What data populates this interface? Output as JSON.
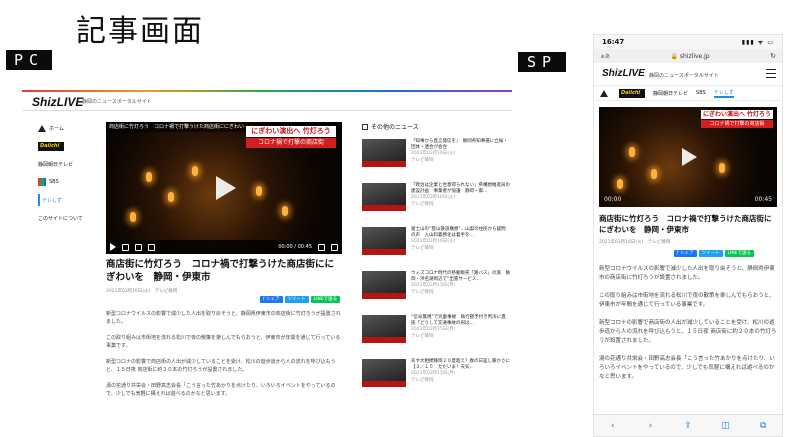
{
  "page_title": "記事画面",
  "labels": {
    "pc": "PC",
    "sp": "SP"
  },
  "site": {
    "logo": "ShizLIVE",
    "tagline": "静岡のニュースポータルサイト",
    "url": "shizlive.jp"
  },
  "pc": {
    "sidebar": [
      {
        "label": "ホーム",
        "icon": "home-icon"
      },
      {
        "label": "Daiichi",
        "icon": "daiichi-tv-logo"
      },
      {
        "label": "静岡朝日テレビ",
        "icon": ""
      },
      {
        "label": "SBS",
        "icon": "sbs-logo"
      },
      {
        "label": "テレしず",
        "icon": ""
      },
      {
        "label": "このサイトについて",
        "icon": ""
      }
    ],
    "video": {
      "top_caption": "商店街に竹灯ろう　コロナ禍で打撃うけた商店街ににぎわい",
      "banner_line1": "にぎわい演出へ 竹灯ろう",
      "banner_line2": "コロナ禍で打撃の商店街",
      "time": "00:00 / 00:45"
    },
    "headline": "商店街に竹灯ろう　コロナ禍で打撃うけた商店街ににぎわいを　静岡・伊東市",
    "date": "2021年03月16日(火)　テレビ静岡",
    "body": [
      "新型コロナウイルスの影響で減少した人出を取り戻そうと、静岡県伊東市の商店街に竹灯ろうが設置されました。",
      "この取り組みは市街地を流れる松川で夜の散策を楽しんでもらおうと、伊東市が年間を通じて行っている事業です。",
      "新型コロナの影響で商店街の人出が減少していることを受け、松川の遊歩道から人の流れを呼び込もうと、１５日夜 商店街に約２０本の竹灯ろうが設置されました。",
      "湯の花通り共栄会・田野高志会長「こう言った竹あかりを点けたり、いろいろイベントをやっているので、少しでも気軽に構えれば遊べるのかなと思います。"
    ],
    "news_title": "その他のニュース",
    "news": [
      {
        "text": "「知事から直言発信を」　静岡県知事選に立候・団体・連合が会合",
        "date": "2021年03月16日(火)",
        "source": "テレビ静岡"
      },
      {
        "text": "「政治は企業と合意得られない」県構想推進局の建設計画　事業者が協議　静岡・御…",
        "date": "2021年03月16日(火)",
        "source": "テレビ静岡"
      },
      {
        "text": "富士山の“登山鉄道構想”…山梨の住民から疑問の声　入山料義務化は着手を…",
        "date": "2021年03月16日(火)",
        "source": "テレビ静岡"
      },
      {
        "text": "ウィズコロナ時代の移動販売「路バス」の旅　静岡・浜名湖周辺で“出張サービス…",
        "date": "2021年03月15日(月)",
        "source": "テレビ静岡"
      },
      {
        "text": "“信号無視”で児童事故　執行猶予付き判決に遺族「どうして交通事故の刑は…",
        "date": "2021年03月15日(月)",
        "source": "テレビ静岡"
      },
      {
        "text": "あす大相撲静岡２０度超え？春の日差し暖かさに【３／１５　ただいま！天気…",
        "date": "2021年03月15日(月)",
        "source": "テレビ静岡"
      }
    ]
  },
  "sp": {
    "status_time": "16:47",
    "status_icons": "▮▮▮ ᯤ ▭",
    "url_left": "ぁあ",
    "tabs": [
      "Daiichi",
      "静岡朝日テレビ",
      "SBS",
      "テレしず"
    ],
    "video_time": "00:00",
    "video_end": "00:45",
    "headline": "商店街に竹灯ろう　コロナ禍で打撃うけた商店街ににぎわいを　静岡・伊東市",
    "date": "2021年03月16日(火)　テレビ静岡",
    "body": [
      "新型コロナウイルスの影響で減少した人出を取り戻そうと、静岡県伊東市の商店街に竹灯ろうが設置されました。",
      "この取り組みは市街地を流れる松川で夜の散策を楽しんでもらおうと、伊東市が年間を通じて行っている事業です。",
      "新型コロナの影響で商店街の人出が減少していることを受け、松川の遊歩道から人の流れを呼び込もうと、１５日夜 商店街に約２０本の竹灯ろうが設置されました。",
      "湯の花通り共栄会・田野高志会長「こう言った竹あかりを点けたり、いろいろイベントをやっているので、少しでも気軽に構えれば遊べるのかなと思います。"
    ]
  },
  "share": {
    "facebook": "f シェア",
    "twitter": "ツイート",
    "line": "LINEで送る"
  },
  "toolbar": [
    "‹",
    "›",
    "⇪",
    "◫",
    "⧉"
  ]
}
